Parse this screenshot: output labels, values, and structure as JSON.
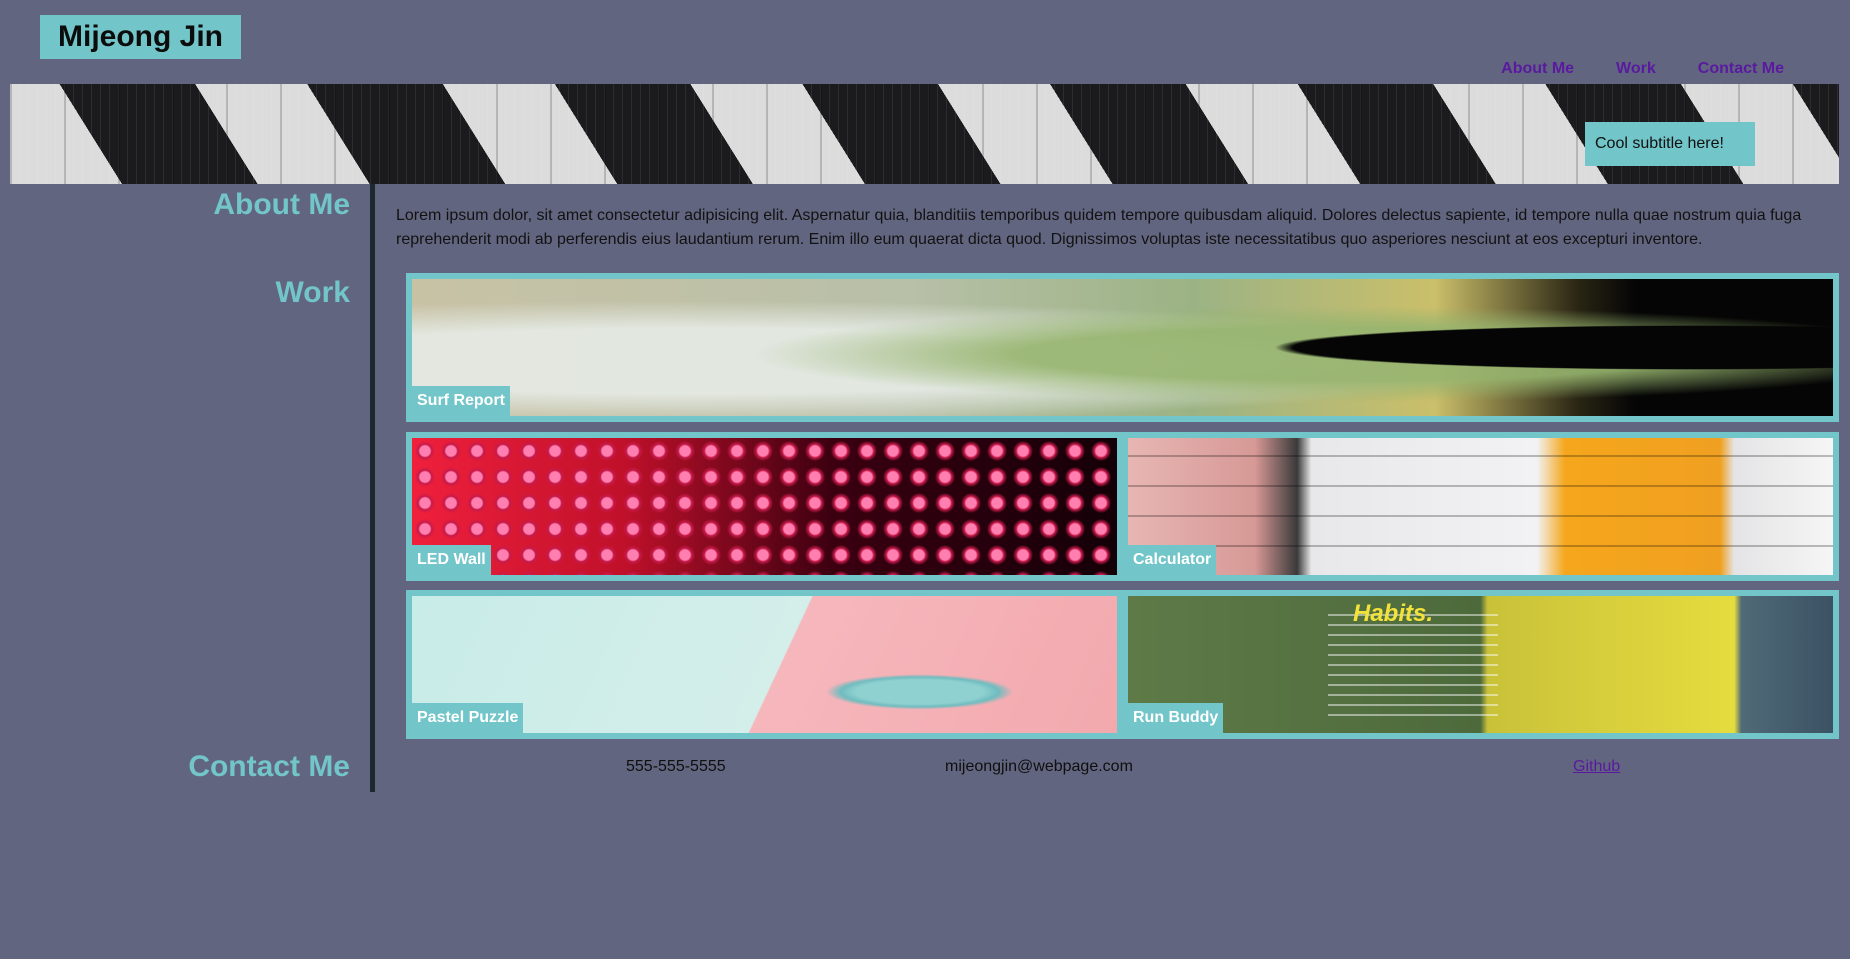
{
  "header": {
    "brand": "Mijeong Jin",
    "nav": [
      "About Me",
      "Work",
      "Contact Me"
    ],
    "subtitle": "Cool subtitle here!"
  },
  "sidebar": {
    "about": "About Me",
    "work": "Work",
    "contact": "Contact Me"
  },
  "about": {
    "text": "Lorem ipsum dolor, sit amet consectetur adipisicing elit. Aspernatur quia, blanditiis temporibus quidem tempore quibusdam aliquid. Dolores delectus sapiente, id tempore nulla quae nostrum quia fuga reprehenderit modi ab perferendis eius laudantium rerum. Enim illo eum quaerat dicta quod. Dignissimos voluptas iste necessitatibus quo asperiores nesciunt at eos excepturi inventore."
  },
  "work": {
    "projects": [
      "Surf Report",
      "LED Wall",
      "Calculator",
      "Pastel Puzzle",
      "Run Buddy"
    ],
    "run_buddy_heading": "Habits."
  },
  "contact": {
    "phone": "555-555-5555",
    "email": "mijeongjin@webpage.com",
    "github": "Github"
  },
  "colors": {
    "background": "#62657f",
    "accent": "#72c5c8",
    "nav_link": "#5a1aa0"
  }
}
